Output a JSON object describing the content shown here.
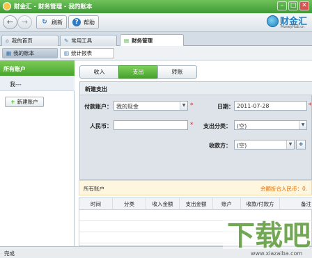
{
  "window": {
    "title": "财金汇 - 财务管理 - 我的账本",
    "min": "–",
    "restore": "□",
    "close": "✕"
  },
  "toolbar": {
    "back": "←",
    "forward": "→",
    "refresh_icon": "↻",
    "refresh_label": "刷新",
    "help_icon": "?",
    "help_label": "帮助",
    "brand_name": "财金汇",
    "brand_sub": "MoneyHub.cn"
  },
  "main_tabs": [
    {
      "label": "我的首页"
    },
    {
      "label": "常用工具"
    },
    {
      "label": "财务管理"
    }
  ],
  "sub_tabs": [
    {
      "label": "我的账本"
    },
    {
      "label": "统计报表"
    }
  ],
  "sidebar": {
    "header": "所有账户",
    "user": "我---",
    "new_account_icon": "+",
    "new_account": "新建账户"
  },
  "txn_tabs": [
    {
      "label": "收入"
    },
    {
      "label": "支出"
    },
    {
      "label": "转账"
    }
  ],
  "form": {
    "title": "新建支出",
    "pay_account_label": "付款账户：",
    "pay_account_value": "我的现金",
    "date_label": "日期：",
    "date_value": "2011-07-28",
    "rmb_label": "人民币：",
    "rmb_value": "",
    "category_label": "支出分类：",
    "category_value": "(空)",
    "payee_label": "收款方：",
    "payee_value": "(空)",
    "payee_add": "+",
    "dropdown_arrow": "▼",
    "required_mark": "*"
  },
  "summary": {
    "left": "所有账户",
    "right": "余额折合人民币：0."
  },
  "table": {
    "columns": [
      "时间",
      "分类",
      "收入金额",
      "支出金额",
      "账户",
      "收款/付款方",
      "备注"
    ]
  },
  "status": {
    "text": "完成"
  },
  "watermark": {
    "text": "下载吧",
    "url": "www.xiazaiba.com"
  },
  "colors": {
    "accent_green": "#4aa632",
    "brand_blue": "#1f7fc0",
    "required_red": "#e02020"
  }
}
